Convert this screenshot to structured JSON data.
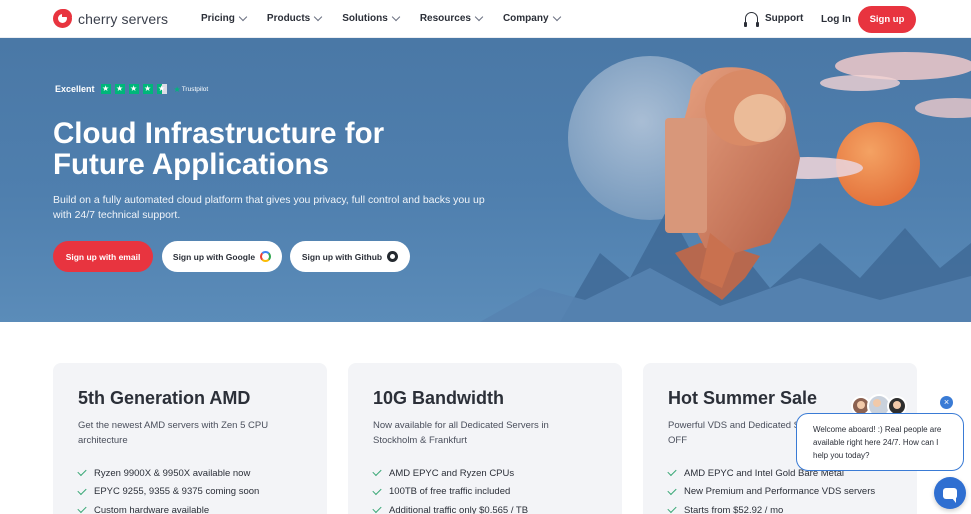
{
  "nav": {
    "logo_text": "cherry servers",
    "menu": [
      {
        "label": "Pricing"
      },
      {
        "label": "Products"
      },
      {
        "label": "Solutions"
      },
      {
        "label": "Resources"
      },
      {
        "label": "Company"
      }
    ],
    "support_label": "Support",
    "login_label": "Log In",
    "signup_label": "Sign up"
  },
  "hero": {
    "trust_rating_word": "Excellent",
    "trust_brand": "Trustpilot",
    "trust_stars": 4.5,
    "title_line1": "Cloud Infrastructure for",
    "title_line2": "Future Applications",
    "subtitle": "Build on a fully automated cloud platform that gives you privacy, full control and backs you up with 24/7 technical support.",
    "buttons": {
      "email": "Sign up with email",
      "google": "Sign up with Google",
      "github": "Sign up with Github"
    }
  },
  "cards": [
    {
      "title": "5th Generation AMD",
      "desc": "Get the newest AMD servers with Zen 5 CPU architecture",
      "features": [
        "Ryzen 9900X & 9950X available now",
        "EPYC 9255, 9355 & 9375 coming soon",
        "Custom hardware available"
      ]
    },
    {
      "title": "10G Bandwidth",
      "desc": "Now available for all Dedicated Servers in Stockholm & Frankfurt",
      "features": [
        "AMD EPYC and Ryzen CPUs",
        "100TB of free traffic included",
        "Additional traffic only $0.565 / TB"
      ]
    },
    {
      "title": "Hot Summer Sale",
      "desc": "Powerful VDS and Dedicated Servers up to 36% OFF",
      "features": [
        "AMD EPYC and Intel Gold Bare Metal",
        "New Premium and Performance VDS servers",
        "Starts from $52.92 / mo"
      ]
    }
  ],
  "chat": {
    "message": "Welcome aboard! :) Real people are available right here 24/7. How can I help you today?",
    "close_glyph": "×"
  },
  "colors": {
    "brand_red": "#e8343f",
    "hero_blue": "#4f7fae",
    "trust_green": "#00b67a",
    "chat_blue": "#3a7bd5"
  }
}
